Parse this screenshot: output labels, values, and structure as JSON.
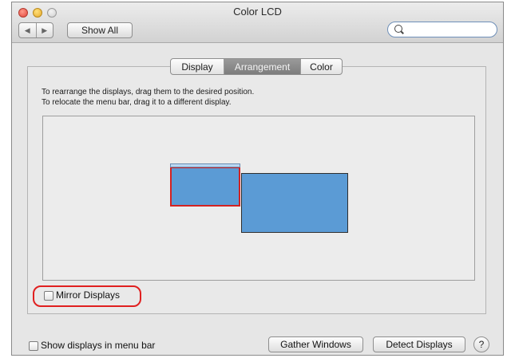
{
  "window": {
    "title": "Color LCD",
    "traffic_lights": [
      "close",
      "minimize",
      "zoom"
    ]
  },
  "toolbar": {
    "back_icon": "left-arrow-icon",
    "forward_icon": "right-arrow-icon",
    "show_all_label": "Show All",
    "search": {
      "value": "",
      "placeholder": "",
      "icon": "magnifier-icon"
    }
  },
  "tabs": [
    {
      "label": "Display",
      "selected": false
    },
    {
      "label": "Arrangement",
      "selected": true
    },
    {
      "label": "Color",
      "selected": false
    }
  ],
  "instructions": {
    "line1": "To rearrange the displays, drag them to the desired position.",
    "line2": "To relocate the menu bar, drag it to a different display."
  },
  "mirror": {
    "label": "Mirror Displays",
    "checked": false
  },
  "menu_bar_option": {
    "label": "Show displays in menu bar",
    "checked": false
  },
  "buttons": {
    "gather_windows": "Gather Windows",
    "detect_displays": "Detect Displays",
    "help": "?"
  },
  "colors": {
    "display_fill": "#5b9bd5",
    "highlight_red": "#e02020",
    "selected_tab": "#8a8a8a"
  }
}
